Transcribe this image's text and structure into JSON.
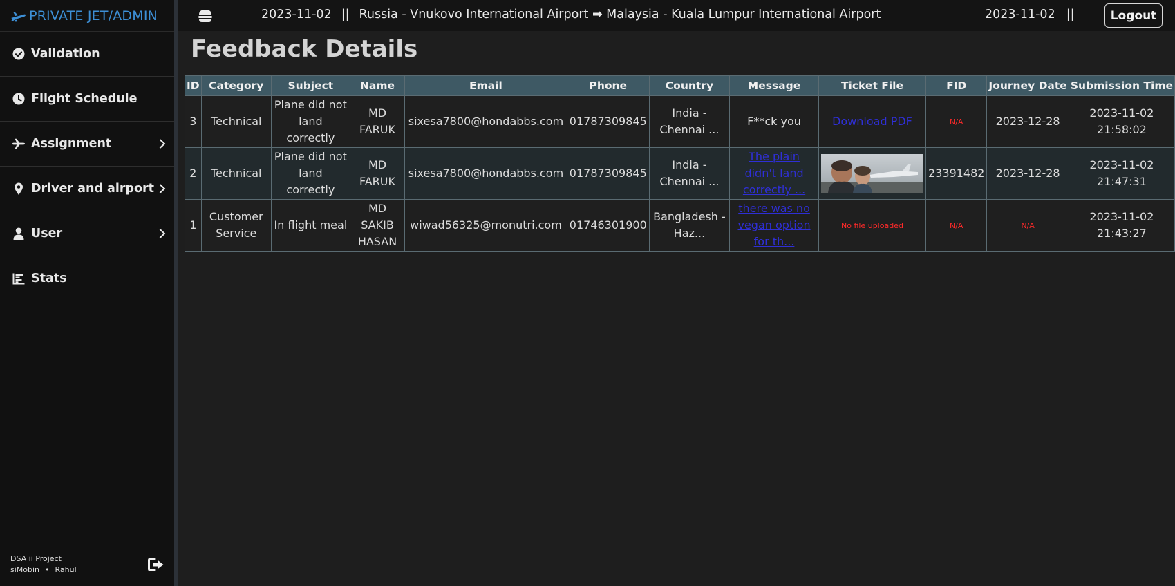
{
  "brand": {
    "text": "PRIVATE JET/ADMIN"
  },
  "sidebar": {
    "items": [
      {
        "label": "Validation",
        "icon": "check-circle-icon",
        "has_chevron": false
      },
      {
        "label": "Flight Schedule",
        "icon": "clock-icon",
        "has_chevron": false
      },
      {
        "label": "Assignment",
        "icon": "plane-icon",
        "has_chevron": true
      },
      {
        "label": "Driver and airport",
        "icon": "map-pin-icon",
        "has_chevron": true
      },
      {
        "label": "User",
        "icon": "user-icon",
        "has_chevron": true
      },
      {
        "label": "Stats",
        "icon": "bar-chart-icon",
        "has_chevron": false
      }
    ],
    "footer": {
      "project": "DSA ii Project",
      "author1": "siMobin",
      "separator": "•",
      "author2": "Rahul"
    }
  },
  "topbar": {
    "date_left": "2023-11-02",
    "separator": "||",
    "route": "Russia - Vnukovo International Airport ➡ Malaysia - Kuala Lumpur International Airport",
    "date_right": "2023-11-02",
    "separator_right": "||",
    "logout_label": "Logout"
  },
  "page": {
    "title": "Feedback Details"
  },
  "table": {
    "headers": [
      "ID",
      "Category",
      "Subject",
      "Name",
      "Email",
      "Phone",
      "Country",
      "Message",
      "Ticket File",
      "FID",
      "Journey Date",
      "Submission Time"
    ],
    "rows": [
      {
        "id": "3",
        "category": "Technical",
        "subject": "Plane did not land correctly",
        "name": "MD FARUK",
        "email": "sixesa7800@hondabbs.com",
        "phone": "01787309845",
        "country": "India - Chennai ...",
        "message": "F**ck you",
        "message_is_link": false,
        "ticket_file": "Download PDF",
        "ticket_type": "link",
        "fid": "N/A",
        "journey_date": "2023-12-28",
        "submission_date": "2023-11-02",
        "submission_time": "21:58:02"
      },
      {
        "id": "2",
        "category": "Technical",
        "subject": "Plane did not land correctly",
        "name": "MD FARUK",
        "email": "sixesa7800@hondabbs.com",
        "phone": "01787309845",
        "country": "India - Chennai ...",
        "message": "The plain didn't land correctly ...",
        "message_is_link": true,
        "ticket_file": "",
        "ticket_type": "image",
        "fid": "23391482",
        "journey_date": "2023-12-28",
        "submission_date": "2023-11-02",
        "submission_time": "21:47:31"
      },
      {
        "id": "1",
        "category": "Customer Service",
        "subject": "In flight meal",
        "name": "MD SAKIB HASAN",
        "email": "wiwad56325@monutri.com",
        "phone": "01746301900",
        "country": "Bangladesh - Haz...",
        "message": "there was no vegan option for th...",
        "message_is_link": true,
        "ticket_file": "No file uploaded",
        "ticket_type": "none",
        "fid": "N/A",
        "journey_date": "N/A",
        "submission_date": "2023-11-02",
        "submission_time": "21:43:27"
      }
    ]
  },
  "colors": {
    "brand": "#3d8fd6",
    "table_header": "#3e5964",
    "link": "#2f2fd6",
    "na": "#ff2a2a"
  }
}
